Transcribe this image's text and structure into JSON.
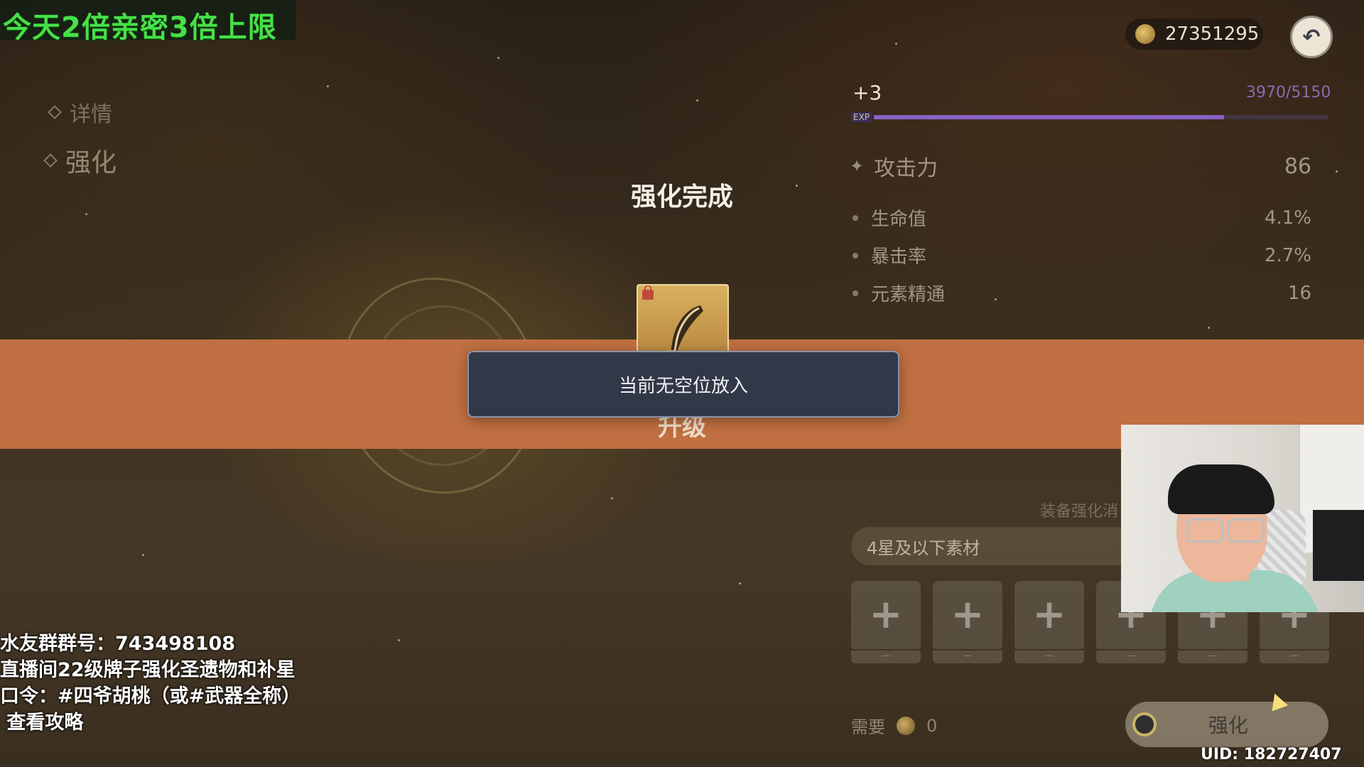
{
  "stream_banner": "今天2倍亲密3倍上限",
  "nav": {
    "detail": "详情",
    "enhance": "强化"
  },
  "currency": {
    "mora": "27351295"
  },
  "artifact": {
    "level": "+3",
    "exp_text": "3970/5150",
    "exp_label": "EXP",
    "exp_fraction": 0.771,
    "main_stat": {
      "name": "攻击力",
      "value": "86"
    },
    "sub_stats": [
      {
        "name": "生命值",
        "value": "4.1%"
      },
      {
        "name": "暴击率",
        "value": "2.7%"
      },
      {
        "name": "元素精通",
        "value": "16"
      }
    ]
  },
  "overlay": {
    "title": "强化完成",
    "upgrade_text": "升级",
    "toast": "当前无空位放入"
  },
  "materials": {
    "caption": "装备强化消",
    "filter": "4星及以下素材",
    "slots": [
      "+",
      "+",
      "+",
      "+",
      "+",
      "+"
    ],
    "slot_dash": "—"
  },
  "cost": {
    "label": "需要",
    "value": "0"
  },
  "enhance_button": "强化",
  "stream_info": {
    "line1": "水友群群号：743498108",
    "line2": "直播间22级牌子强化圣遗物和补星",
    "line3": "口令：#四爷胡桃（或#武器全称）",
    "line4": " 查看攻略"
  },
  "uid": "UID: 182727407"
}
